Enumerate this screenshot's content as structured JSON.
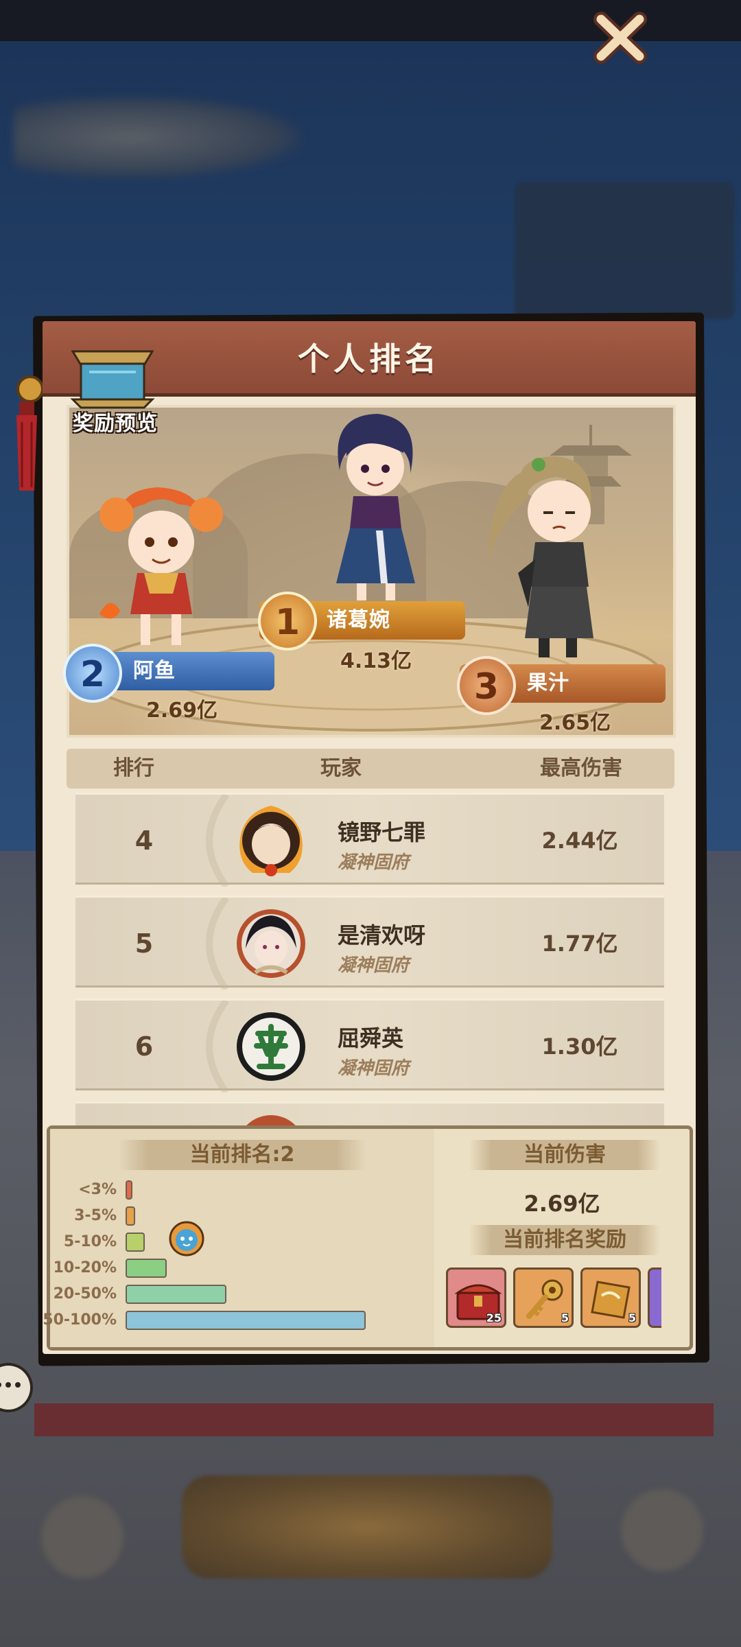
{
  "modal": {
    "title": "个人排名",
    "reward_preview_label": "奖励预览"
  },
  "podium": [
    {
      "rank": "1",
      "name": "诸葛婉",
      "damage": "4.13亿"
    },
    {
      "rank": "2",
      "name": "阿鱼",
      "damage": "2.69亿"
    },
    {
      "rank": "3",
      "name": "果汁",
      "damage": "2.65亿"
    }
  ],
  "table": {
    "headers": {
      "rank": "排行",
      "player": "玩家",
      "damage": "最高伤害"
    },
    "rows": [
      {
        "rank": "4",
        "name": "镜野七罪",
        "guild": "凝神固府",
        "damage": "2.44亿",
        "avatar": "flame-portrait-icon"
      },
      {
        "rank": "5",
        "name": "是清欢呀",
        "guild": "凝神固府",
        "damage": "1.77亿",
        "avatar": "lady-portrait-icon"
      },
      {
        "rank": "6",
        "name": "屈舜英",
        "guild": "凝神固府",
        "damage": "1.30亿",
        "avatar": "mahjong-fa-icon"
      }
    ]
  },
  "summary": {
    "current_rank_label": "当前排名:2",
    "distribution": [
      {
        "label": "<3%",
        "fill": 0.02,
        "color": "#e06a4a"
      },
      {
        "label": "3-5%",
        "fill": 0.04,
        "color": "#e8a04a"
      },
      {
        "label": "5-10%",
        "fill": 0.08,
        "color": "#b8d06a"
      },
      {
        "label": "10-20%",
        "fill": 0.17,
        "color": "#8ccf84"
      },
      {
        "label": "20-50%",
        "fill": 0.42,
        "color": "#8fd0a8"
      },
      {
        "label": "50-100%",
        "fill": 1.0,
        "color": "#8dc4da"
      }
    ],
    "current_damage_label": "当前伤害",
    "current_damage": "2.69亿",
    "current_reward_label": "当前排名奖励",
    "rewards": [
      {
        "icon": "treasure-chest-icon",
        "count": "25",
        "color": "#e08a8a"
      },
      {
        "icon": "golden-key-icon",
        "count": "5",
        "color": "#e6a25a"
      },
      {
        "icon": "scroll-ticket-icon",
        "count": "5",
        "color": "#e6a25a"
      }
    ]
  }
}
